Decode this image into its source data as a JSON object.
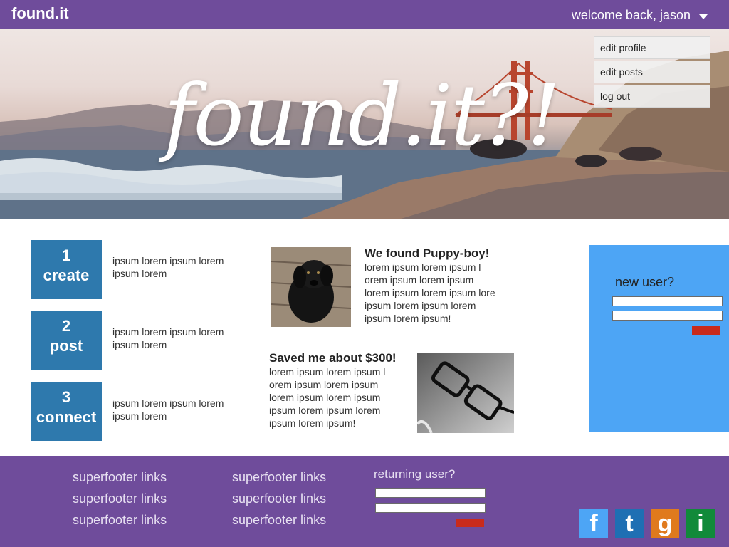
{
  "topbar": {
    "logo": "found.it",
    "welcome": "welcome back, jason"
  },
  "hero": {
    "title": "found.it?!"
  },
  "user_menu": {
    "items": [
      {
        "label": "edit profile"
      },
      {
        "label": "edit posts"
      },
      {
        "label": "log out"
      }
    ]
  },
  "steps": [
    {
      "num": "1",
      "word": "create",
      "text": "ipsum lorem ipsum lorem ipsum lorem"
    },
    {
      "num": "2",
      "word": "post",
      "text": "ipsum lorem ipsum lorem ipsum lorem"
    },
    {
      "num": "3",
      "word": "connect",
      "text": "ipsum lorem ipsum lorem ipsum lorem"
    }
  ],
  "stories": [
    {
      "title": "We found Puppy-boy!",
      "lines": [
        "lorem ipsum lorem ipsum l",
        "orem ipsum lorem ipsum",
        "lorem ipsum lorem ipsum lore",
        "ipsum lorem ipsum lorem",
        "ipsum lorem ipsum!"
      ],
      "image": "black-puppy"
    },
    {
      "title": "Saved me about $300!",
      "lines": [
        "lorem ipsum lorem ipsum l",
        "orem ipsum lorem ipsum",
        "lorem ipsum lorem ipsum",
        "ipsum lorem ipsum lorem",
        "ipsum lorem ipsum!"
      ],
      "image": "eyeglasses"
    }
  ],
  "new_user": {
    "label": "new user?"
  },
  "footer": {
    "links_col1": [
      "superfooter links",
      "superfooter links",
      "superfooter links"
    ],
    "links_col2": [
      "superfooter links",
      "superfooter links",
      "superfooter links"
    ],
    "returning_label": "returning user?",
    "social": [
      {
        "letter": "f",
        "icon": "facebook-icon",
        "color": "#4da5f5"
      },
      {
        "letter": "t",
        "icon": "twitter-icon",
        "color": "#1f6fb3"
      },
      {
        "letter": "g",
        "icon": "google-icon",
        "color": "#e07a1d"
      },
      {
        "letter": "i",
        "icon": "instagram-icon",
        "color": "#118a3a"
      }
    ]
  },
  "colors": {
    "brand_purple": "#6f4c9b",
    "step_blue": "#2e79ad",
    "panel_blue": "#4da5f5",
    "submit_red": "#c92b1c"
  }
}
